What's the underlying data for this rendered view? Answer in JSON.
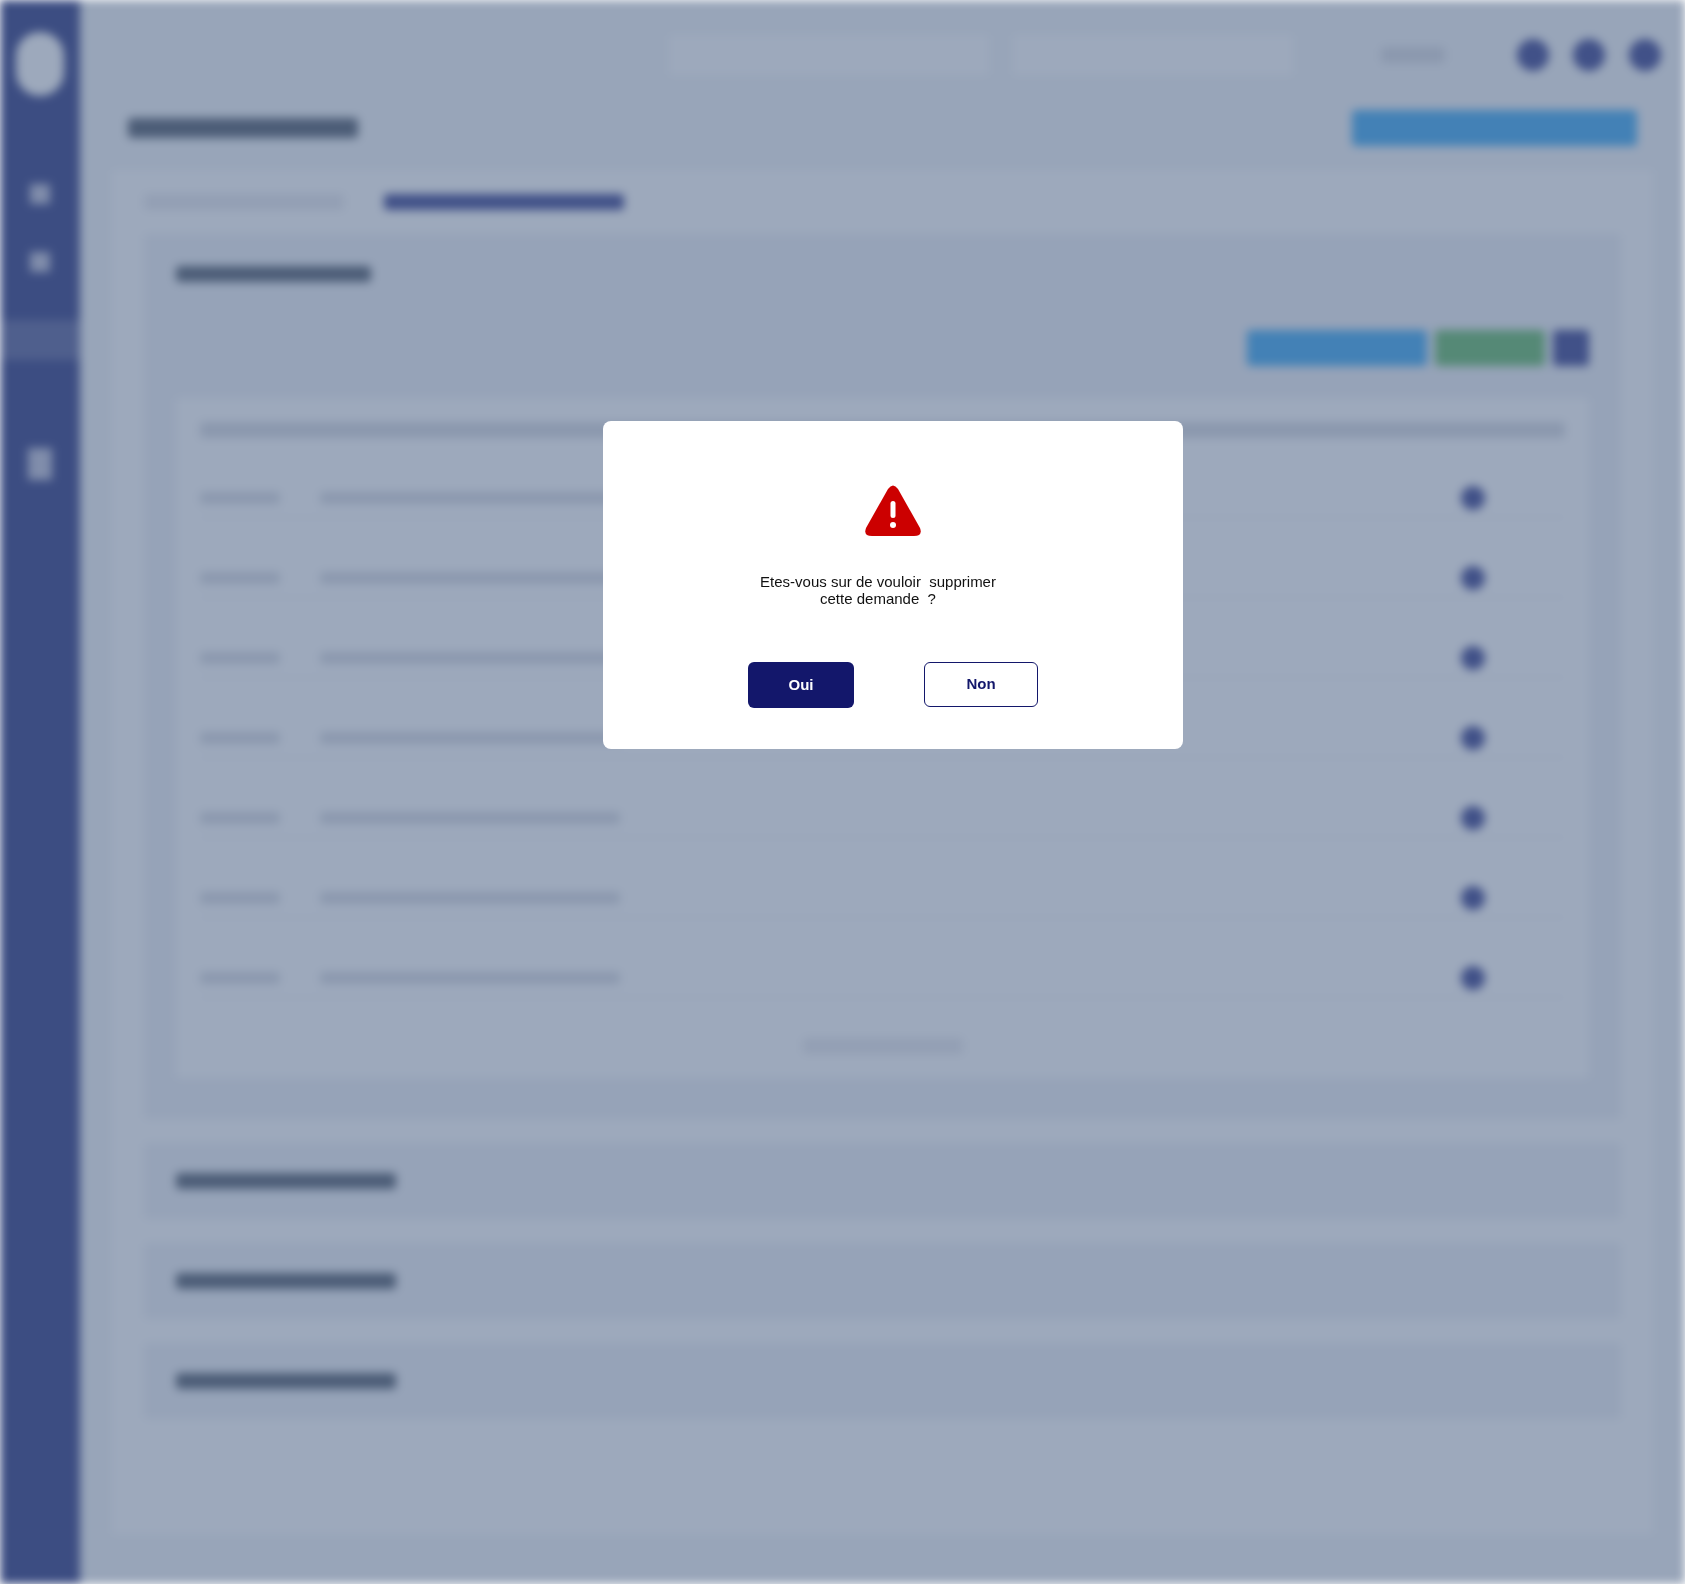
{
  "dialog": {
    "message": "Etes-vous sur de vouloir  supprimer\ncette demande  ?",
    "buttons": [
      {
        "label": "Oui",
        "kind": "primary"
      },
      {
        "label": "Non",
        "kind": "secondary"
      }
    ]
  }
}
